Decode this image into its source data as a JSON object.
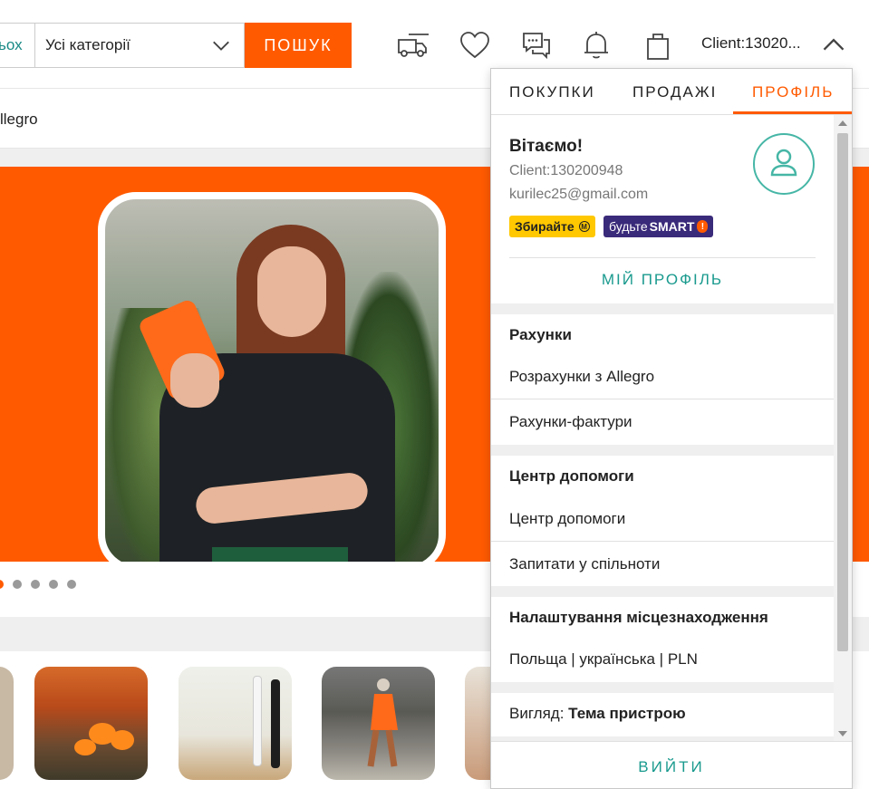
{
  "header": {
    "search_left_fragment": "ьох",
    "category_value": "Усі категорії",
    "search_button": "ПОШУК",
    "client_label": "Client:13020...",
    "icons": [
      "delivery-truck-icon",
      "heart-icon",
      "messages-icon",
      "bell-icon",
      "bag-icon",
      "chevron-up-icon"
    ]
  },
  "subbar": {
    "text": "llegro"
  },
  "carousel": {
    "dots": 4,
    "active_index": 0
  },
  "panel": {
    "tabs": [
      {
        "label": "ПОКУПКИ",
        "active": false
      },
      {
        "label": "ПРОДАЖІ",
        "active": false
      },
      {
        "label": "ПРОФІЛЬ",
        "active": true
      }
    ],
    "greeting": "Вітаємо!",
    "client_id": "Client:130200948",
    "email": "kurilec25@gmail.com",
    "badge_collect": "Збирайте",
    "badge_collect_mark": "M",
    "badge_smart_prefix": "будьте",
    "badge_smart_word": "SMART",
    "badge_smart_mark": "!",
    "my_profile": "МІЙ ПРОФІЛЬ",
    "sections": [
      {
        "title": "Рахунки",
        "items": [
          "Розрахунки з Allegro",
          "Рахунки-фактури"
        ]
      },
      {
        "title": "Центр допомоги",
        "items": [
          "Центр допомоги",
          "Запитати у спільноти"
        ]
      },
      {
        "title": "Налаштування місцезнаходження",
        "items": [
          "Польща | українська | PLN"
        ]
      }
    ],
    "view_label": "Вигляд:",
    "view_value": "Тема пристрою",
    "logout": "ВИЙТИ"
  },
  "colors": {
    "accent": "#ff5a00",
    "teal": "#1a9a8e",
    "avatar_ring": "#46b6a6",
    "badge_yellow": "#ffc800",
    "badge_purple": "#3a2a7a"
  }
}
